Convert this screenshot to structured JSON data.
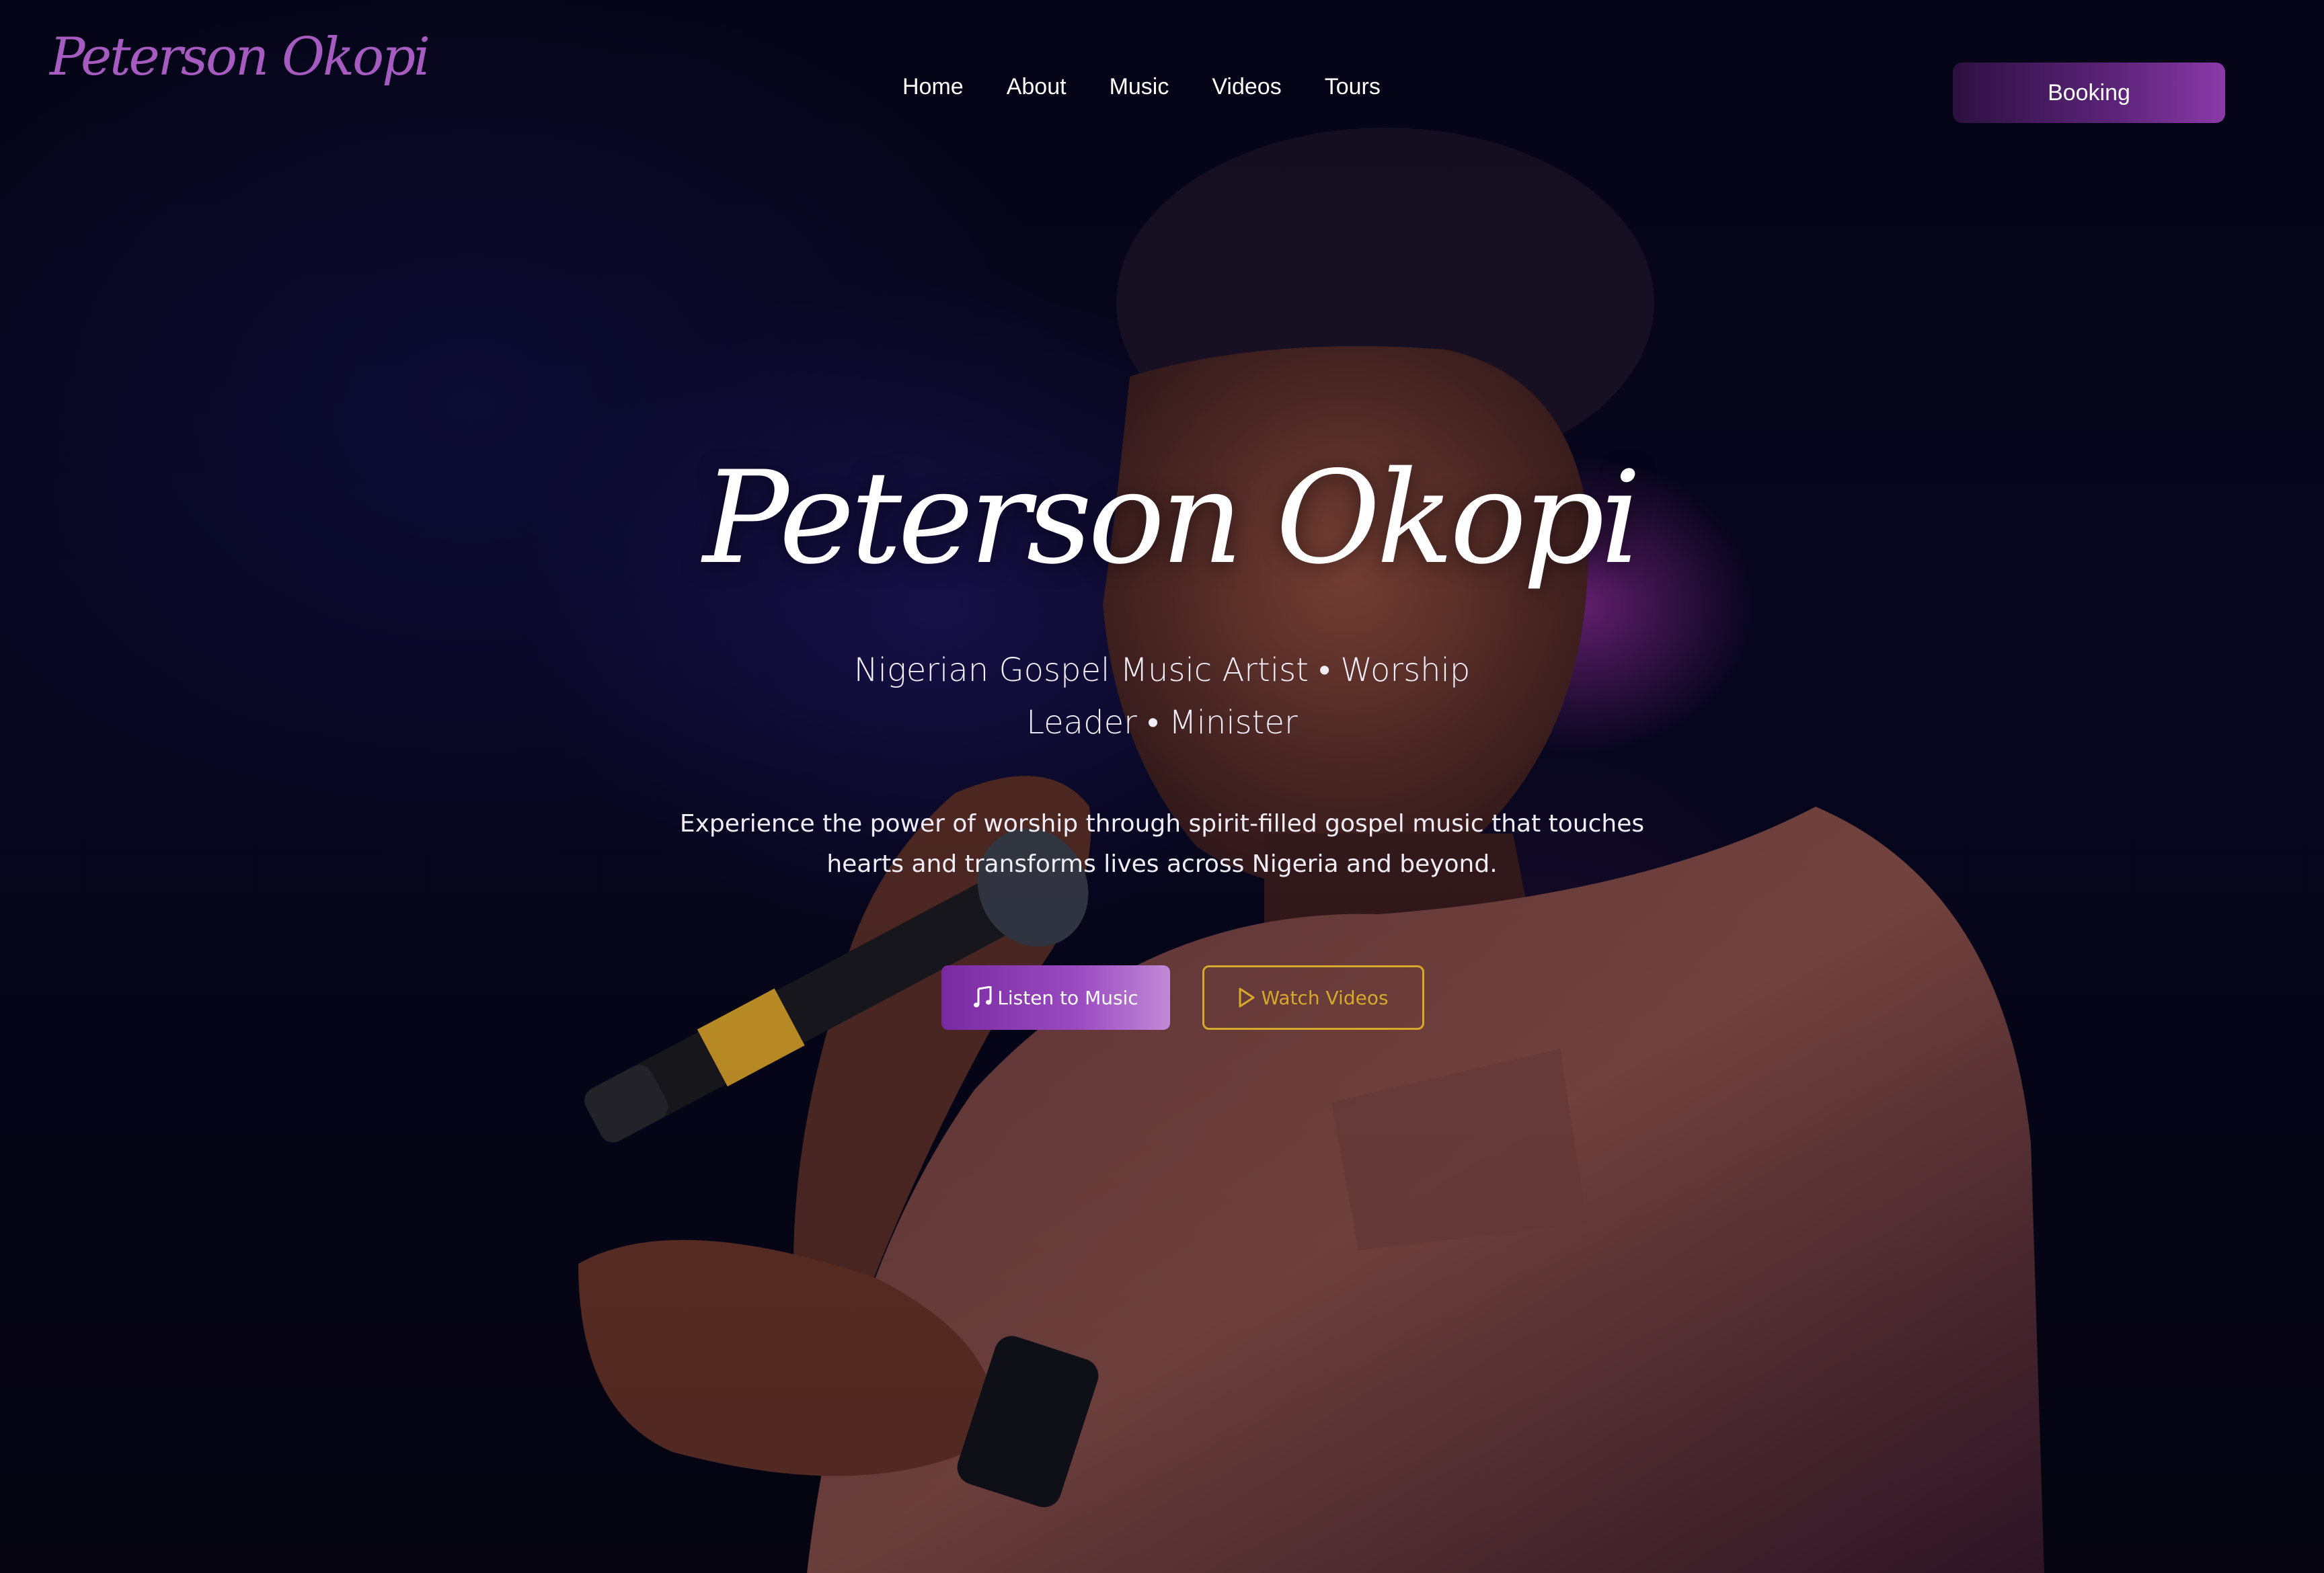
{
  "brand": {
    "logo_text": "Peterson Okopi",
    "accent_color": "#8b3aa8",
    "gold_color": "#d6a92b"
  },
  "nav": {
    "items": [
      {
        "label": "Home"
      },
      {
        "label": "About"
      },
      {
        "label": "Music"
      },
      {
        "label": "Videos"
      },
      {
        "label": "Tours"
      }
    ],
    "booking_label": "Booking"
  },
  "hero": {
    "title": "Peterson Okopi",
    "subtitle": "Nigerian Gospel Music Artist • Worship Leader • Minister",
    "description": "Experience the power of worship through spirit-filled gospel music that touches hearts and transforms lives across Nigeria and beyond.",
    "buttons": {
      "listen_label": "Listen to Music",
      "listen_icon": "music-note-icon",
      "watch_label": "Watch Videos",
      "watch_icon": "play-icon"
    }
  }
}
